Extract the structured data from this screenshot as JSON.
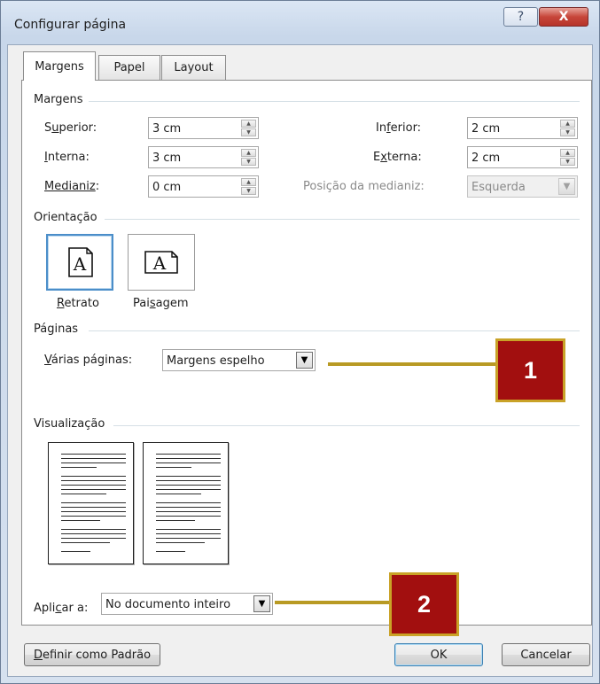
{
  "window": {
    "title": "Configurar página",
    "help_glyph": "?",
    "close_glyph": "X"
  },
  "tabs": [
    {
      "label": "Margens",
      "active": true
    },
    {
      "label": "Papel",
      "active": false
    },
    {
      "label": "Layout",
      "active": false
    }
  ],
  "margins": {
    "section_title": "Margens",
    "superior": {
      "label_pre": "S",
      "label_u": "u",
      "label_post": "perior:",
      "value": "3 cm"
    },
    "interna": {
      "label_pre": "",
      "label_u": "I",
      "label_post": "nterna:",
      "value": "3 cm"
    },
    "medianiz": {
      "label_pre": "Medianiz",
      "label_u": "",
      "label_post": ":",
      "value": "0 cm"
    },
    "inferior": {
      "label_pre": "In",
      "label_u": "f",
      "label_post": "erior:",
      "value": "2 cm"
    },
    "externa": {
      "label_pre": "E",
      "label_u": "x",
      "label_post": "terna:",
      "value": "2 cm"
    },
    "posicao_medianiz": {
      "label": "Posição da medianiz:",
      "value": "Esquerda"
    }
  },
  "orientation": {
    "section_title": "Orientação",
    "icon_letter": "A",
    "retrato": {
      "label_pre": "",
      "label_u": "R",
      "label_post": "etrato",
      "selected": true
    },
    "paisagem": {
      "label_pre": "Pai",
      "label_u": "s",
      "label_post": "agem",
      "selected": false
    }
  },
  "pages": {
    "section_title": "Páginas",
    "varias_paginas": {
      "label_pre": "",
      "label_u": "V",
      "label_post": "árias páginas:",
      "value": "Margens espelho"
    }
  },
  "preview": {
    "section_title": "Visualização"
  },
  "apply_to": {
    "label_pre": "Apli",
    "label_u": "c",
    "label_post": "ar a:",
    "value": "No documento inteiro"
  },
  "buttons": {
    "set_default": {
      "label_pre": "",
      "label_u": "D",
      "label_post": "efinir como Padrão"
    },
    "ok": "OK",
    "cancel": "Cancelar"
  },
  "callouts": [
    {
      "number": "1"
    },
    {
      "number": "2"
    }
  ],
  "colors": {
    "callout_fill": "#a20f0f",
    "callout_border": "#c9a227",
    "selection_blue": "#4b8ec9"
  }
}
